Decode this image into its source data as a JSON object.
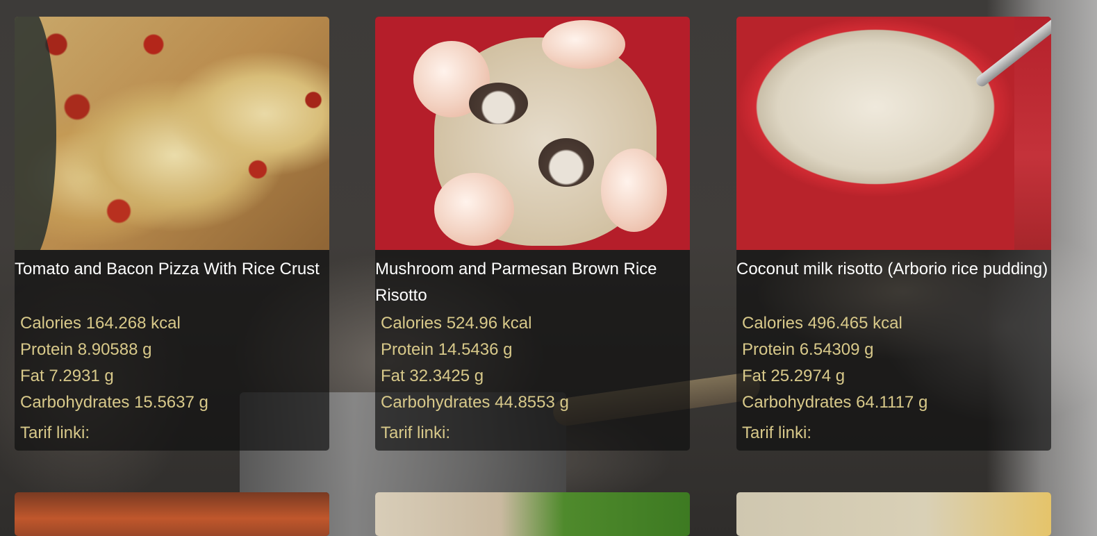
{
  "recipes": [
    {
      "title": "Tomato and Bacon Pizza With Rice Crust",
      "calories": "Calories 164.268 kcal",
      "protein": "Protein 8.90588 g",
      "fat": "Fat 7.2931 g",
      "carbohydrates": "Carbohydrates 15.5637 g",
      "link_label": "Tarif linki:"
    },
    {
      "title": "Mushroom and Parmesan Brown Rice Risotto",
      "calories": "Calories 524.96 kcal",
      "protein": "Protein 14.5436 g",
      "fat": "Fat 32.3425 g",
      "carbohydrates": "Carbohydrates 44.8553 g",
      "link_label": "Tarif linki:"
    },
    {
      "title": "Coconut milk risotto (Arborio rice pudding)",
      "calories": "Calories 496.465 kcal",
      "protein": "Protein 6.54309 g",
      "fat": "Fat 25.2974 g",
      "carbohydrates": "Carbohydrates 64.1117 g",
      "link_label": "Tarif linki:"
    }
  ],
  "colors": {
    "title_text": "#ffffff",
    "nutrient_text": "#d8c98a",
    "card_background": "rgba(14,14,14,0.66)"
  }
}
